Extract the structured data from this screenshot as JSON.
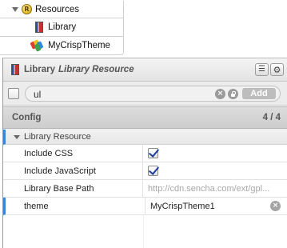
{
  "tree": {
    "root_label": "Resources",
    "root_icon": "resources-icon",
    "items": [
      {
        "label": "Library",
        "icon": "library-icon"
      },
      {
        "label": "MyCrispTheme",
        "icon": "theme-palette-icon"
      }
    ]
  },
  "panel": {
    "title": "Library",
    "subtitle": "Library Resource",
    "buttons": [
      {
        "icon": "layout-options-icon"
      },
      {
        "icon": "gear-icon"
      }
    ]
  },
  "filter": {
    "value": "ul",
    "add_label": "Add"
  },
  "section": {
    "title": "Config",
    "count": "4 / 4"
  },
  "group": {
    "label": "Library Resource"
  },
  "properties": [
    {
      "name": "Include CSS",
      "type": "checkbox",
      "checked": true
    },
    {
      "name": "Include JavaScript",
      "type": "checkbox",
      "checked": true
    },
    {
      "name": "Library Base Path",
      "type": "text",
      "value": "http://cdn.sencha.com/ext/gpl..."
    },
    {
      "name": "theme",
      "type": "text",
      "value": "MyCrispTheme1"
    }
  ],
  "colors": {
    "accent": "#3b85d8",
    "panel_bg": "#ededed",
    "muted_text": "#a8a8a8"
  }
}
